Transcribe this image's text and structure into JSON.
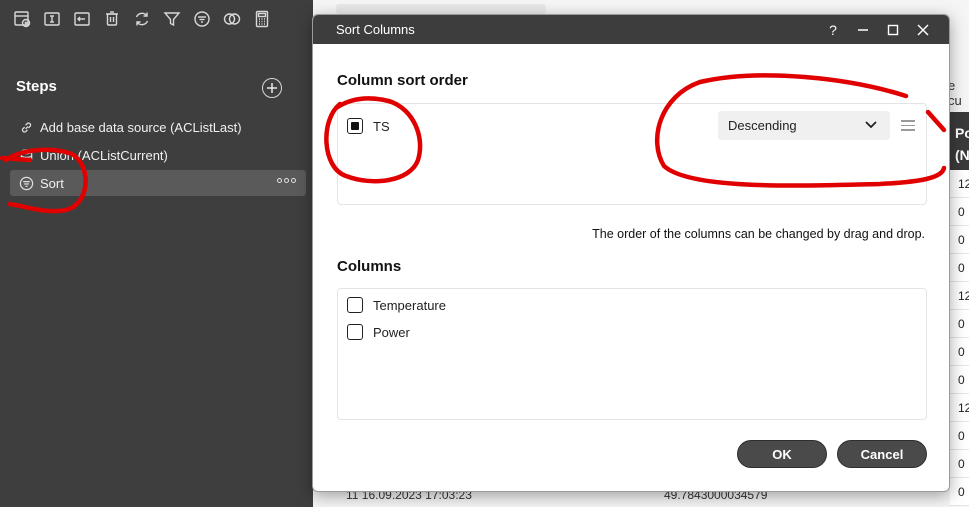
{
  "sidebar": {
    "toolbar_icons": [
      "add-datasource-icon",
      "text-field-icon",
      "import-icon",
      "trash-icon",
      "refresh-icon",
      "filter-icon",
      "sort-filter-icon",
      "merge-icon",
      "calculator-icon"
    ],
    "steps_title": "Steps",
    "steps": [
      {
        "label": "Add base data source (ACListLast)",
        "icon": "link-icon"
      },
      {
        "label": "Union (ACListCurrent)",
        "icon": "database-icon"
      },
      {
        "label": "Sort",
        "icon": "sort-icon",
        "active": true
      }
    ]
  },
  "background": {
    "text_fragment": "e cu",
    "grid_header": "Po\n(N",
    "grid_values": [
      "12",
      "0",
      "0",
      "0",
      "12",
      "0",
      "0",
      "0",
      "12",
      "0",
      "0",
      "0"
    ],
    "partial_row_left": "11   16.09.2023 17:03:23",
    "partial_row_right": "49.7843000034579"
  },
  "dialog": {
    "title": "Sort Columns",
    "controls": {
      "help": "?"
    },
    "sort_order_title": "Column sort order",
    "sort_items": [
      {
        "label": "TS",
        "checked": true,
        "direction": "Descending"
      }
    ],
    "hint": "The order of the columns can be changed by drag and drop.",
    "columns_title": "Columns",
    "columns": [
      {
        "label": "Temperature",
        "checked": false
      },
      {
        "label": "Power",
        "checked": false
      }
    ],
    "ok_label": "OK",
    "cancel_label": "Cancel"
  },
  "colors": {
    "sidebar_bg": "#3e3e3e",
    "titlebar_bg": "#3d3d3d",
    "button_bg": "#4a4a4a",
    "annotation_red": "#e00000"
  }
}
